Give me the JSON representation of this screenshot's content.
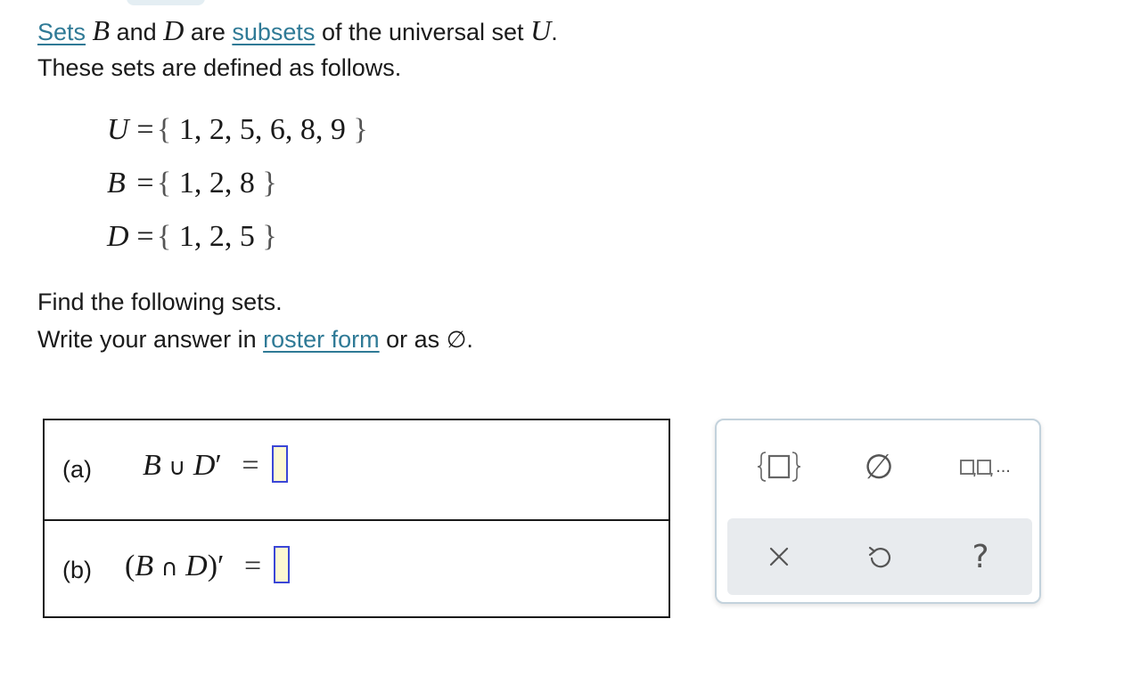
{
  "intro": {
    "sets_link": "Sets",
    "var_b": "B",
    "and_text": "and",
    "var_d": "D",
    "are_text": "are",
    "subsets_link": "subsets",
    "of_text": "of the universal set",
    "var_u": "U",
    "period": ".",
    "line2": "These sets are defined as follows."
  },
  "definitions": [
    {
      "name": "U",
      "elements": "1, 2, 5, 6, 8, 9"
    },
    {
      "name": "B",
      "elements": "1, 2, 8"
    },
    {
      "name": "D",
      "elements": "1, 2, 5"
    }
  ],
  "instructions": {
    "line1": "Find the following sets.",
    "line2_prefix": "Write your answer in",
    "roster_link": "roster form",
    "line2_suffix": "or as",
    "empty_symbol": "∅",
    "period": "."
  },
  "questions": [
    {
      "part": "(a)",
      "expression": {
        "a": "B",
        "op": "∪",
        "b": "D",
        "prime": "′"
      },
      "equals": "=",
      "answer": ""
    },
    {
      "part": "(b)",
      "expression": {
        "open": "(",
        "a": "B",
        "op": "∩",
        "b": "D",
        "close": ")",
        "prime": "′"
      },
      "equals": "=",
      "answer": ""
    }
  ],
  "palette": {
    "buttons": [
      {
        "name": "set-braces-button",
        "icon": "set-braces-icon"
      },
      {
        "name": "empty-set-button",
        "icon": "empty-set-icon",
        "symbol": "∅"
      },
      {
        "name": "list-button",
        "icon": "list-icon",
        "symbol": "..."
      }
    ],
    "actions": [
      {
        "name": "clear-button",
        "icon": "close-icon",
        "symbol": "✕"
      },
      {
        "name": "undo-button",
        "icon": "undo-icon"
      },
      {
        "name": "help-button",
        "icon": "help-icon",
        "symbol": "?"
      }
    ]
  },
  "colors": {
    "link": "#2f7a96",
    "answer_box_border": "#3b46d6",
    "answer_box_fill": "#fdf8d2",
    "palette_border": "#c3d2dc",
    "palette_action_bg": "#e8ebee"
  }
}
